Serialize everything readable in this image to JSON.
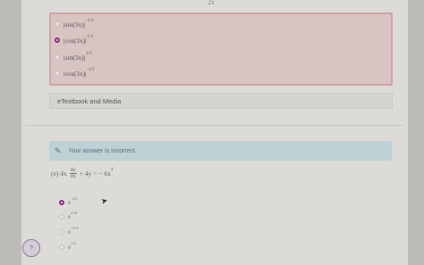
{
  "top_stub": "2x",
  "prev_choices": [
    {
      "base": "|sin(3x)|",
      "exp": "-1/3",
      "selected": false
    },
    {
      "base": "|cos(3x)|",
      "exp": "1/3",
      "selected": true
    },
    {
      "base": "|sin(3x)|",
      "exp": "1/3",
      "selected": false
    },
    {
      "base": "|cos(3x)|",
      "exp": "-1/3",
      "selected": false
    }
  ],
  "etextbook_label": "eTextbook and Media",
  "alert": {
    "text": "Your answer is incorrect.",
    "icon": "pencil-icon"
  },
  "question": {
    "prefix": "(e) 4x",
    "frac_num": "dy",
    "frac_den": "dx",
    "rest": "+ 4y = − 6x",
    "rest_exp": "4"
  },
  "options": [
    {
      "base": "e",
      "exp": "-x/4",
      "selected": true
    },
    {
      "base": "e",
      "exp": "x²/4",
      "selected": false
    },
    {
      "base": "e",
      "exp": "-x²/4",
      "selected": false
    },
    {
      "base": "e",
      "exp": "x/4",
      "selected": false
    }
  ],
  "help_label": "?",
  "colors": {
    "selected_radio": "#8a2c7e",
    "incorrect_panel": "#d8c4c3",
    "alert_bg": "#bcd2d6"
  }
}
